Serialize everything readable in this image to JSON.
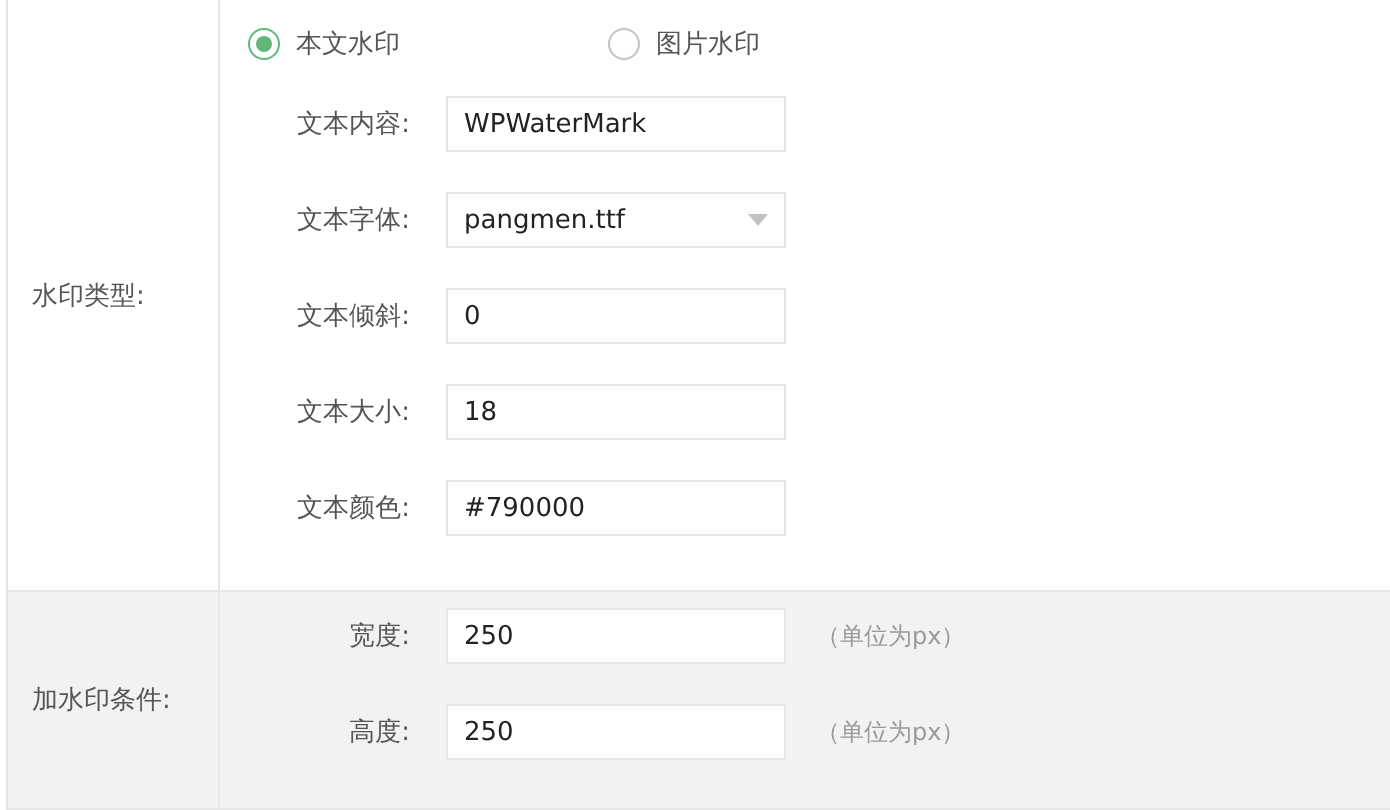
{
  "sections": [
    {
      "label": "水印类型:",
      "radios": [
        {
          "label": "本文水印",
          "selected": true
        },
        {
          "label": "图片水印",
          "selected": false
        }
      ],
      "fields": [
        {
          "kind": "text",
          "label": "文本内容:",
          "value": "WPWaterMark"
        },
        {
          "kind": "select",
          "label": "文本字体:",
          "value": "pangmen.ttf"
        },
        {
          "kind": "text",
          "label": "文本倾斜:",
          "value": "0"
        },
        {
          "kind": "text",
          "label": "文本大小:",
          "value": "18"
        },
        {
          "kind": "text",
          "label": "文本颜色:",
          "value": "#790000"
        }
      ]
    },
    {
      "label": "加水印条件:",
      "shaded": true,
      "fields": [
        {
          "kind": "text",
          "label": "宽度:",
          "value": "250",
          "unit": "（单位为px）"
        },
        {
          "kind": "text",
          "label": "高度:",
          "value": "250",
          "unit": "（单位为px）"
        }
      ]
    }
  ]
}
